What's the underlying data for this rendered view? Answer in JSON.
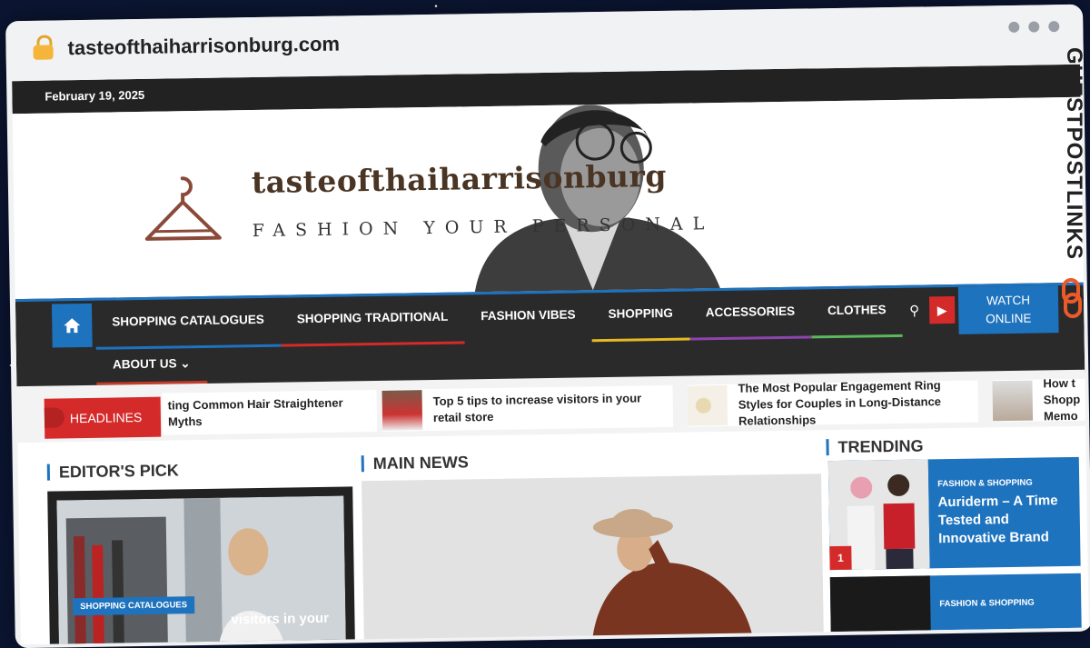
{
  "browser": {
    "url": "tasteofthaiharrisonburg.com"
  },
  "topbar": {
    "date": "February 19, 2025"
  },
  "header": {
    "title": "tasteofthaiharrisonburg",
    "tagline": "FASHION YOUR PERSONAL"
  },
  "nav": {
    "items": [
      {
        "label": "SHOPPING CATALOGUES",
        "color": "#1e73be"
      },
      {
        "label": "SHOPPING TRADITIONAL",
        "color": "#d52a2a"
      },
      {
        "label": "FASHION VIBES",
        "color": "#2a2a2a"
      },
      {
        "label": "SHOPPING",
        "color": "#e8b923"
      },
      {
        "label": "ACCESSORIES",
        "color": "#8e44ad"
      },
      {
        "label": "CLOTHES",
        "color": "#5cb85c"
      }
    ],
    "about": "ABOUT US ⌄",
    "watch_line1": "WATCH",
    "watch_line2": "ONLINE"
  },
  "headlines": {
    "label": "HEADLINES",
    "items": [
      {
        "text": "ting Common Hair Straightener Myths"
      },
      {
        "text": "Top 5 tips to increase visitors in your retail store"
      },
      {
        "text": "The Most Popular Engagement Ring Styles for Couples in Long-Distance Relationships"
      },
      {
        "text": "How t Shopp Memo"
      }
    ]
  },
  "editors_pick": {
    "title": "EDITOR'S PICK",
    "badge": "SHOPPING CATALOGUES",
    "caption": "visitors in your"
  },
  "main_news": {
    "title": "MAIN NEWS"
  },
  "trending": {
    "title": "TRENDING",
    "items": [
      {
        "category": "FASHION & SHOPPING",
        "headline": "Auriderm – A Time Tested and Innovative Brand",
        "rank": "1"
      },
      {
        "category": "FASHION & SHOPPING"
      }
    ]
  },
  "watermark": "GUESTPOSTLINKS"
}
